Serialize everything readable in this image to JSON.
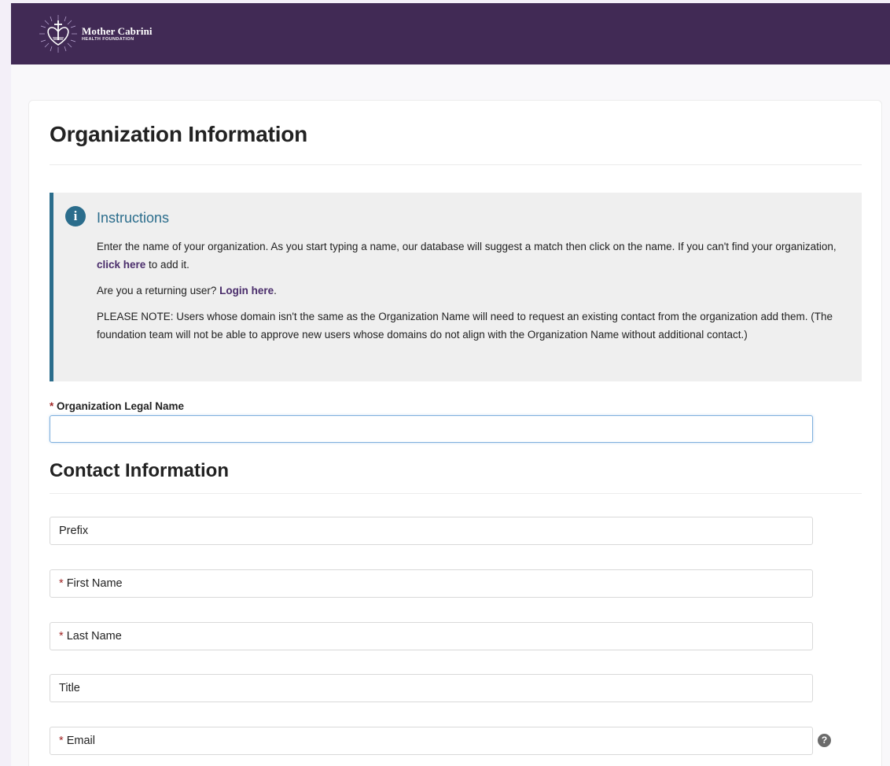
{
  "header": {
    "logo_name": "Mother Cabrini",
    "logo_subtitle": "HEALTH FOUNDATION",
    "background_color": "#412a55"
  },
  "page_title": "Organization Information",
  "instructions": {
    "icon": "info-icon",
    "title": "Instructions",
    "p1_before": "Enter the name of your organization. As you start typing a name, our database will suggest a match then click on the name. If you can't find your organization, ",
    "p1_link": "click here",
    "p1_after": " to add it.",
    "p2_before": "Are you a returning user? ",
    "p2_link": "Login here",
    "p2_after": ".",
    "p3": "PLEASE NOTE: Users whose domain isn't the same as the Organization Name will need to request an existing contact from the organization add them. (The foundation team will not be able to approve new users whose domains do not align with the Organization Name without additional contact.)",
    "accent_color": "#2b6d8c"
  },
  "org_field": {
    "required_marker": "*",
    "label": "Organization Legal Name",
    "value": ""
  },
  "contact_section_title": "Contact Information",
  "contact_fields": {
    "prefix": {
      "label": "Prefix"
    },
    "first_name": {
      "required_marker": "*",
      "label": "First Name"
    },
    "last_name": {
      "required_marker": "*",
      "label": "Last Name"
    },
    "title": {
      "label": "Title"
    },
    "email": {
      "required_marker": "*",
      "label": "Email",
      "help_icon": "question-circle-icon"
    }
  }
}
